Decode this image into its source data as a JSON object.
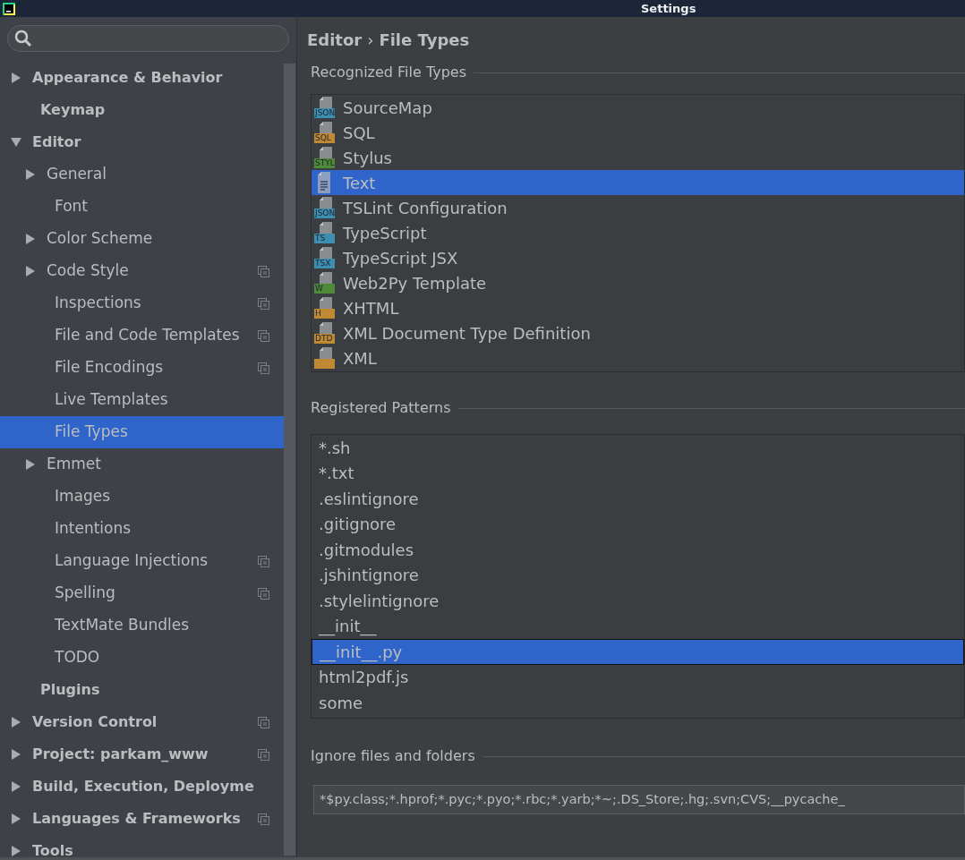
{
  "window": {
    "title": "Settings"
  },
  "sidebar": {
    "items": [
      {
        "label": "Appearance & Behavior",
        "kind": "folder",
        "expanded": false,
        "selected": false,
        "scoped": false
      },
      {
        "label": "Keymap",
        "kind": "leaf",
        "selected": false,
        "scoped": false
      },
      {
        "label": "Editor",
        "kind": "folder",
        "expanded": true,
        "selected": false,
        "scoped": false,
        "children": [
          {
            "label": "General",
            "kind": "folder",
            "expanded": false,
            "selected": false,
            "scoped": false
          },
          {
            "label": "Font",
            "kind": "leaf",
            "selected": false,
            "scoped": false
          },
          {
            "label": "Color Scheme",
            "kind": "folder",
            "expanded": false,
            "selected": false,
            "scoped": false
          },
          {
            "label": "Code Style",
            "kind": "folder",
            "expanded": false,
            "selected": false,
            "scoped": true
          },
          {
            "label": "Inspections",
            "kind": "leaf",
            "selected": false,
            "scoped": true
          },
          {
            "label": "File and Code Templates",
            "kind": "leaf",
            "selected": false,
            "scoped": true
          },
          {
            "label": "File Encodings",
            "kind": "leaf",
            "selected": false,
            "scoped": true
          },
          {
            "label": "Live Templates",
            "kind": "leaf",
            "selected": false,
            "scoped": false
          },
          {
            "label": "File Types",
            "kind": "leaf",
            "selected": true,
            "scoped": false
          },
          {
            "label": "Emmet",
            "kind": "folder",
            "expanded": false,
            "selected": false,
            "scoped": false
          },
          {
            "label": "Images",
            "kind": "leaf",
            "selected": false,
            "scoped": false
          },
          {
            "label": "Intentions",
            "kind": "leaf",
            "selected": false,
            "scoped": false
          },
          {
            "label": "Language Injections",
            "kind": "leaf",
            "selected": false,
            "scoped": true
          },
          {
            "label": "Spelling",
            "kind": "leaf",
            "selected": false,
            "scoped": true
          },
          {
            "label": "TextMate Bundles",
            "kind": "leaf",
            "selected": false,
            "scoped": false
          },
          {
            "label": "TODO",
            "kind": "leaf",
            "selected": false,
            "scoped": false
          }
        ]
      },
      {
        "label": "Plugins",
        "kind": "leaf",
        "selected": false,
        "scoped": false
      },
      {
        "label": "Version Control",
        "kind": "folder",
        "expanded": false,
        "selected": false,
        "scoped": true
      },
      {
        "label": "Project: parkam_www",
        "kind": "folder",
        "expanded": false,
        "selected": false,
        "scoped": true
      },
      {
        "label": "Build, Execution, Deployme",
        "kind": "folder",
        "expanded": false,
        "selected": false,
        "scoped": false
      },
      {
        "label": "Languages & Frameworks",
        "kind": "folder",
        "expanded": false,
        "selected": false,
        "scoped": true
      },
      {
        "label": "Tools",
        "kind": "folder",
        "expanded": false,
        "selected": false,
        "scoped": false
      }
    ]
  },
  "breadcrumb": [
    "Editor",
    "›",
    "File Types"
  ],
  "file_types": {
    "title": "Recognized File Types",
    "items": [
      {
        "name": "SourceMap",
        "kind": "badge",
        "badge": "JSON",
        "color": "#3d8fb0",
        "selected": false
      },
      {
        "name": "SQL",
        "kind": "badge",
        "badge": "SQL",
        "color": "#c08a35",
        "selected": false
      },
      {
        "name": "Stylus",
        "kind": "badge",
        "badge": "STYL",
        "color": "#4e8a3a",
        "selected": false
      },
      {
        "name": "Text",
        "kind": "text",
        "selected": true
      },
      {
        "name": "TSLint Configuration",
        "kind": "badge",
        "badge": "JSON",
        "color": "#3d8fb0",
        "selected": false
      },
      {
        "name": "TypeScript",
        "kind": "badge",
        "badge": "TS",
        "color": "#3d8fb0",
        "selected": false
      },
      {
        "name": "TypeScript JSX",
        "kind": "badge",
        "badge": "TSX",
        "color": "#3d8fb0",
        "selected": false
      },
      {
        "name": "Web2Py Template",
        "kind": "badge",
        "badge": "W",
        "color": "#4e8a3a",
        "selected": false
      },
      {
        "name": "XHTML",
        "kind": "badge",
        "badge": "H",
        "color": "#c08a35",
        "selected": false
      },
      {
        "name": "XML Document Type Definition",
        "kind": "badge",
        "badge": "DTD",
        "color": "#c08a35",
        "selected": false
      },
      {
        "name": "XML",
        "kind": "badge",
        "color": "#c08a35",
        "selected": false
      }
    ]
  },
  "patterns": {
    "title": "Registered Patterns",
    "items": [
      {
        "name": "*.sh",
        "selected": false
      },
      {
        "name": "*.txt",
        "selected": false
      },
      {
        "name": ".eslintignore",
        "selected": false
      },
      {
        "name": ".gitignore",
        "selected": false
      },
      {
        "name": ".gitmodules",
        "selected": false
      },
      {
        "name": ".jshintignore",
        "selected": false
      },
      {
        "name": ".stylelintignore",
        "selected": false
      },
      {
        "name": "__init__",
        "selected": false
      },
      {
        "name": "__init__.py",
        "selected": true
      },
      {
        "name": "html2pdf.js",
        "selected": false
      },
      {
        "name": "some",
        "selected": false
      }
    ]
  },
  "ignore": {
    "title": "Ignore files and folders",
    "value": "*$py.class;*.hprof;*.pyc;*.pyo;*.rbc;*.yarb;*~;.DS_Store;.hg;.svn;CVS;__pycache_"
  }
}
